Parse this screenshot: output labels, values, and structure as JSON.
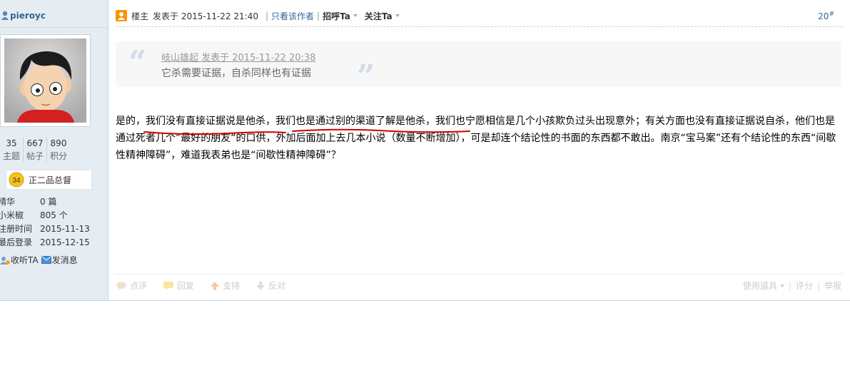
{
  "author": {
    "name": "pieroyc",
    "stats": [
      {
        "value": "35",
        "label": "主题"
      },
      {
        "value": "667",
        "label": "帖子"
      },
      {
        "value": "890",
        "label": "积分"
      }
    ],
    "group_level": "34",
    "group_name": "正二品总督",
    "info": [
      {
        "key": "精华",
        "value": "0 篇"
      },
      {
        "key": "小米椒",
        "value": "805 个"
      },
      {
        "key": "注册时间",
        "value": "2015-11-13"
      },
      {
        "key": "最后登录",
        "value": "2015-12-15"
      }
    ],
    "actions": {
      "follow": "收听TA",
      "message": "发消息"
    }
  },
  "post": {
    "author_tag": "楼主",
    "posted_at": "发表于 2015-11-22 21:40",
    "only_author": "只看该作者",
    "greet": "招呼Ta",
    "follow": "关注Ta",
    "floor": "20",
    "floor_mark": "#",
    "quote": {
      "meta": "岐山雄起 发表于 2015-11-22 20:38",
      "text": "它杀需要证据，自杀同样也有证据"
    },
    "content": "是的，我们没有直接证据说是他杀，我们也是通过别的渠道了解是他杀，我们也宁愿相信是几个小孩欺负过头出现意外；有关方面也没有直接证据说自杀，他们也是通过死者几个”最好的朋友“的口供，外加后面加上去几本小说（数量不断增加），可是却连个结论性的书面的东西都不敢出。南京“宝马案”还有个结论性的东西“间歇性精神障碍”，难道我表弟也是“间歇性精神障碍”？",
    "footer": {
      "rate": "点评",
      "reply": "回复",
      "support": "支持",
      "oppose": "反对",
      "tools": "使用道具",
      "score": "评分",
      "report": "举报"
    }
  },
  "colors": {
    "link": "#336699",
    "sidebar_bg": "#e5edf2",
    "annotation": "#cc0000"
  }
}
